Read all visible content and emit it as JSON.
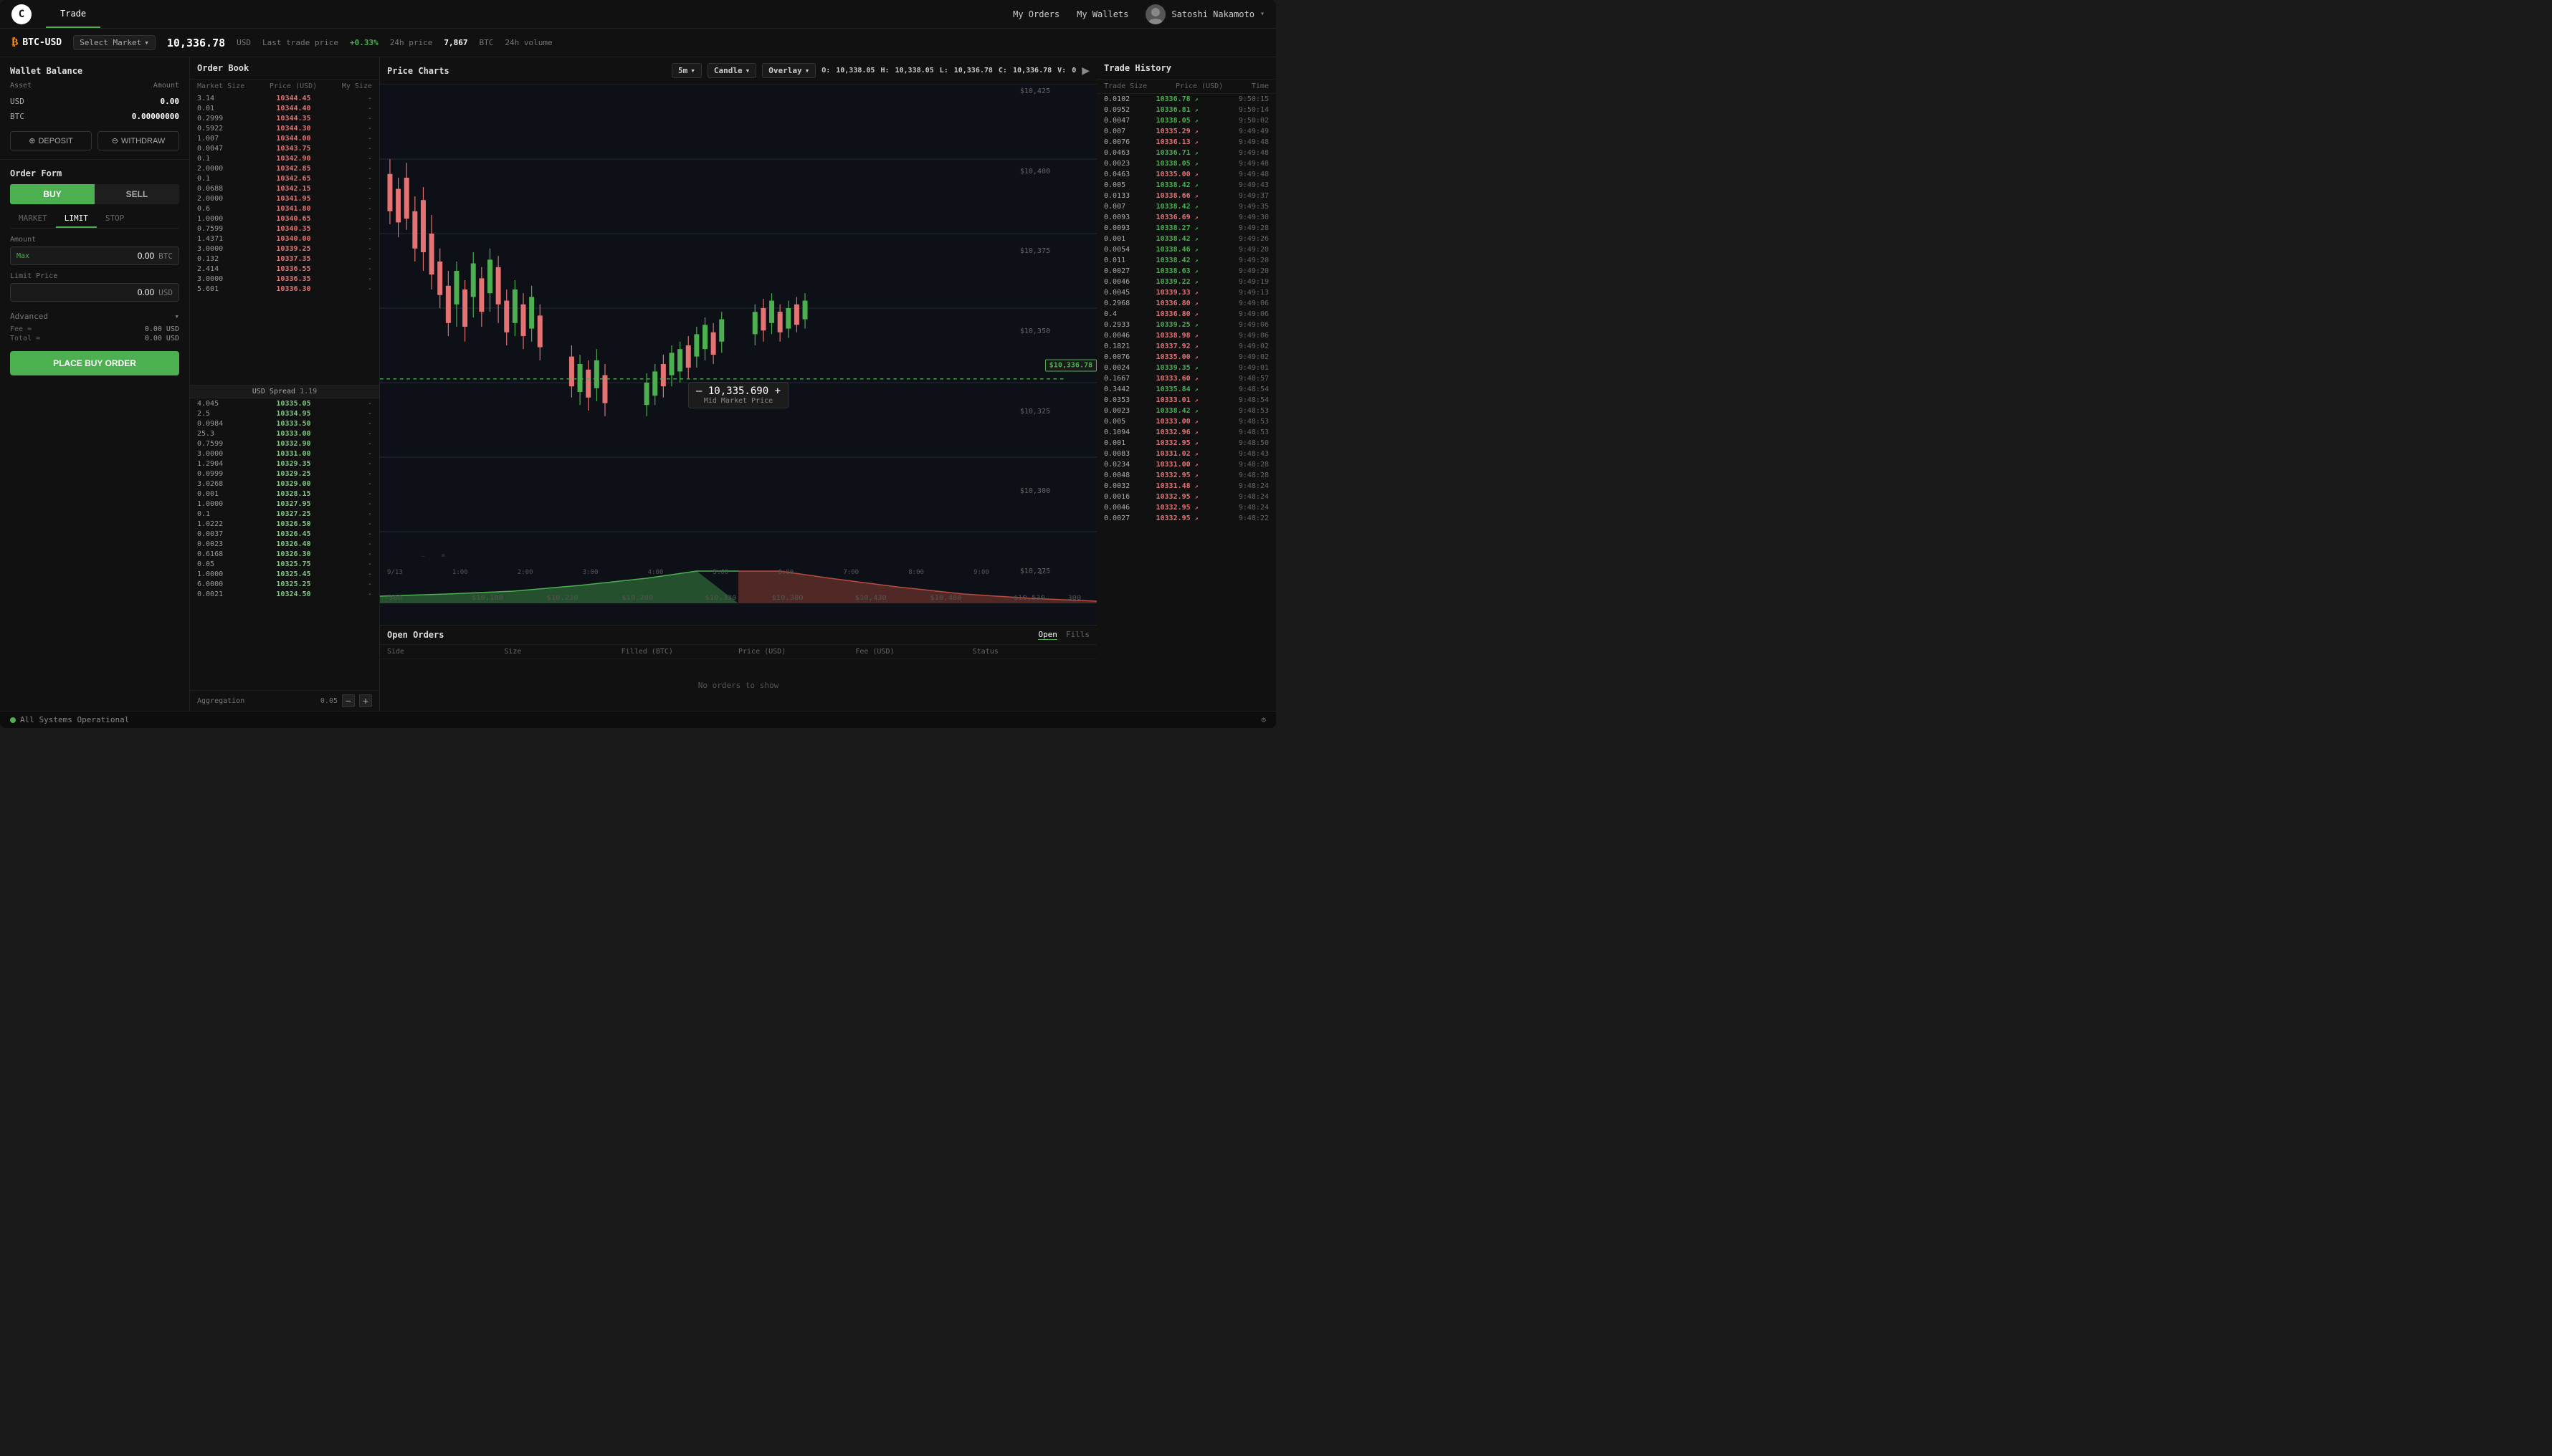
{
  "app": {
    "logo": "C",
    "nav_tabs": [
      {
        "label": "Trade",
        "active": true
      }
    ],
    "nav_right": {
      "my_orders": "My Orders",
      "my_wallets": "My Wallets",
      "user_name": "Satoshi Nakamoto"
    }
  },
  "ticker": {
    "pair": "BTC-USD",
    "icon": "₿",
    "select_market": "Select Market",
    "last_price": "10,336.78",
    "last_price_currency": "USD",
    "last_price_label": "Last trade price",
    "change_24h": "+0.33%",
    "change_label": "24h price",
    "volume_24h": "7,867",
    "volume_currency": "BTC",
    "volume_label": "24h volume"
  },
  "wallet": {
    "title": "Wallet Balance",
    "col_asset": "Asset",
    "col_amount": "Amount",
    "assets": [
      {
        "symbol": "USD",
        "amount": "0.00"
      },
      {
        "symbol": "BTC",
        "amount": "0.00000000"
      }
    ],
    "deposit_label": "DEPOSIT",
    "withdraw_label": "WITHDRAW"
  },
  "order_form": {
    "title": "Order Form",
    "buy_label": "BUY",
    "sell_label": "SELL",
    "order_types": [
      "MARKET",
      "LIMIT",
      "STOP"
    ],
    "active_type": "LIMIT",
    "amount_label": "Amount",
    "amount_max": "Max",
    "amount_value": "0.00",
    "amount_unit": "BTC",
    "limit_price_label": "Limit Price",
    "limit_value": "0.00",
    "limit_unit": "USD",
    "advanced_label": "Advanced",
    "fee_label": "Fee ≈",
    "fee_value": "0.00 USD",
    "total_label": "Total ≈",
    "total_value": "0.00 USD",
    "place_order_btn": "PLACE BUY ORDER"
  },
  "order_book": {
    "title": "Order Book",
    "col_market_size": "Market Size",
    "col_price": "Price (USD)",
    "col_my_size": "My Size",
    "asks": [
      {
        "size": "3.14",
        "price": "10344.45",
        "my_size": "-"
      },
      {
        "size": "0.01",
        "price": "10344.40",
        "my_size": "-"
      },
      {
        "size": "0.2999",
        "price": "10344.35",
        "my_size": "-"
      },
      {
        "size": "0.5922",
        "price": "10344.30",
        "my_size": "-"
      },
      {
        "size": "1.007",
        "price": "10344.00",
        "my_size": "-"
      },
      {
        "size": "0.0047",
        "price": "10343.75",
        "my_size": "-"
      },
      {
        "size": "0.1",
        "price": "10342.90",
        "my_size": "-"
      },
      {
        "size": "2.0000",
        "price": "10342.85",
        "my_size": "-"
      },
      {
        "size": "0.1",
        "price": "10342.65",
        "my_size": "-"
      },
      {
        "size": "0.0688",
        "price": "10342.15",
        "my_size": "-"
      },
      {
        "size": "2.0000",
        "price": "10341.95",
        "my_size": "-"
      },
      {
        "size": "0.6",
        "price": "10341.80",
        "my_size": "-"
      },
      {
        "size": "1.0000",
        "price": "10340.65",
        "my_size": "-"
      },
      {
        "size": "0.7599",
        "price": "10340.35",
        "my_size": "-"
      },
      {
        "size": "1.4371",
        "price": "10340.00",
        "my_size": "-"
      },
      {
        "size": "3.0000",
        "price": "10339.25",
        "my_size": "-"
      },
      {
        "size": "0.132",
        "price": "10337.35",
        "my_size": "-"
      },
      {
        "size": "2.414",
        "price": "10336.55",
        "my_size": "-"
      },
      {
        "size": "3.0000",
        "price": "10336.35",
        "my_size": "-"
      },
      {
        "size": "5.601",
        "price": "10336.30",
        "my_size": "-"
      }
    ],
    "spread_label": "USD Spread",
    "spread_value": "1.19",
    "bids": [
      {
        "size": "4.045",
        "price": "10335.05",
        "my_size": "-"
      },
      {
        "size": "2.5",
        "price": "10334.95",
        "my_size": "-"
      },
      {
        "size": "0.0984",
        "price": "10333.50",
        "my_size": "-"
      },
      {
        "size": "25.3",
        "price": "10333.00",
        "my_size": "-"
      },
      {
        "size": "0.7599",
        "price": "10332.90",
        "my_size": "-"
      },
      {
        "size": "3.0000",
        "price": "10331.00",
        "my_size": "-"
      },
      {
        "size": "1.2904",
        "price": "10329.35",
        "my_size": "-"
      },
      {
        "size": "0.0999",
        "price": "10329.25",
        "my_size": "-"
      },
      {
        "size": "3.0268",
        "price": "10329.00",
        "my_size": "-"
      },
      {
        "size": "0.001",
        "price": "10328.15",
        "my_size": "-"
      },
      {
        "size": "1.0000",
        "price": "10327.95",
        "my_size": "-"
      },
      {
        "size": "0.1",
        "price": "10327.25",
        "my_size": "-"
      },
      {
        "size": "1.0222",
        "price": "10326.50",
        "my_size": "-"
      },
      {
        "size": "0.0037",
        "price": "10326.45",
        "my_size": "-"
      },
      {
        "size": "0.0023",
        "price": "10326.40",
        "my_size": "-"
      },
      {
        "size": "0.6168",
        "price": "10326.30",
        "my_size": "-"
      },
      {
        "size": "0.05",
        "price": "10325.75",
        "my_size": "-"
      },
      {
        "size": "1.0000",
        "price": "10325.45",
        "my_size": "-"
      },
      {
        "size": "6.0000",
        "price": "10325.25",
        "my_size": "-"
      },
      {
        "size": "0.0021",
        "price": "10324.50",
        "my_size": "-"
      }
    ],
    "aggregation_label": "Aggregation",
    "aggregation_value": "0.05"
  },
  "price_chart": {
    "title": "Price Charts",
    "timeframe": "5m",
    "chart_type": "Candle",
    "overlay": "Overlay",
    "ohlcv": {
      "o_label": "O:",
      "o_val": "10,338.05",
      "h_label": "H:",
      "h_val": "10,338.05",
      "l_label": "L:",
      "l_val": "10,336.78",
      "c_label": "C:",
      "c_val": "10,336.78",
      "v_label": "V:",
      "v_val": "0"
    },
    "price_labels": [
      "$10,425",
      "$10,400",
      "$10,375",
      "$10,350",
      "$10,325",
      "$10,300",
      "$10,275"
    ],
    "current_price_label": "$10,336.78",
    "time_labels": [
      "9/13",
      "1:00",
      "2:00",
      "3:00",
      "4:00",
      "5:00",
      "6:00",
      "7:00",
      "8:00",
      "9:00",
      "1:"
    ],
    "mid_market_price": "— 10,335.690 +",
    "mid_market_label": "Mid Market Price",
    "depth_labels": [
      "-300",
      "$10,180",
      "$10,230",
      "$10,280",
      "$10,330",
      "$10,380",
      "$10,430",
      "$10,480",
      "$10,530",
      "300"
    ]
  },
  "open_orders": {
    "title": "Open Orders",
    "tabs": [
      "Open",
      "Fills"
    ],
    "active_tab": "Open",
    "columns": [
      "Side",
      "Size",
      "Filled (BTC)",
      "Price (USD)",
      "Fee (USD)",
      "Status"
    ],
    "empty_message": "No orders to show"
  },
  "trade_history": {
    "title": "Trade History",
    "col_size": "Trade Size",
    "col_price": "Price (USD)",
    "col_time": "Time",
    "rows": [
      {
        "size": "0.0102",
        "price": "10336.78",
        "dir": "up",
        "time": "9:50:15"
      },
      {
        "size": "0.0952",
        "price": "10336.81",
        "dir": "up",
        "time": "9:50:14"
      },
      {
        "size": "0.0047",
        "price": "10338.05",
        "dir": "up",
        "time": "9:50:02"
      },
      {
        "size": "0.007",
        "price": "10335.29",
        "dir": "dn",
        "time": "9:49:49"
      },
      {
        "size": "0.0076",
        "price": "10336.13",
        "dir": "dn",
        "time": "9:49:48"
      },
      {
        "size": "0.0463",
        "price": "10336.71",
        "dir": "up",
        "time": "9:49:48"
      },
      {
        "size": "0.0023",
        "price": "10338.05",
        "dir": "up",
        "time": "9:49:48"
      },
      {
        "size": "0.0463",
        "price": "10335.00",
        "dir": "dn",
        "time": "9:49:48"
      },
      {
        "size": "0.005",
        "price": "10338.42",
        "dir": "up",
        "time": "9:49:43"
      },
      {
        "size": "0.0133",
        "price": "10338.66",
        "dir": "dn",
        "time": "9:49:37"
      },
      {
        "size": "0.007",
        "price": "10338.42",
        "dir": "up",
        "time": "9:49:35"
      },
      {
        "size": "0.0093",
        "price": "10336.69",
        "dir": "dn",
        "time": "9:49:30"
      },
      {
        "size": "0.0093",
        "price": "10338.27",
        "dir": "up",
        "time": "9:49:28"
      },
      {
        "size": "0.001",
        "price": "10338.42",
        "dir": "up",
        "time": "9:49:26"
      },
      {
        "size": "0.0054",
        "price": "10338.46",
        "dir": "up",
        "time": "9:49:20"
      },
      {
        "size": "0.011",
        "price": "10338.42",
        "dir": "up",
        "time": "9:49:20"
      },
      {
        "size": "0.0027",
        "price": "10338.63",
        "dir": "up",
        "time": "9:49:20"
      },
      {
        "size": "0.0046",
        "price": "10339.22",
        "dir": "up",
        "time": "9:49:19"
      },
      {
        "size": "0.0045",
        "price": "10339.33",
        "dir": "dn",
        "time": "9:49:13"
      },
      {
        "size": "0.2968",
        "price": "10336.80",
        "dir": "dn",
        "time": "9:49:06"
      },
      {
        "size": "0.4",
        "price": "10336.80",
        "dir": "dn",
        "time": "9:49:06"
      },
      {
        "size": "0.2933",
        "price": "10339.25",
        "dir": "up",
        "time": "9:49:06"
      },
      {
        "size": "0.0046",
        "price": "10338.98",
        "dir": "dn",
        "time": "9:49:06"
      },
      {
        "size": "0.1821",
        "price": "10337.92",
        "dir": "dn",
        "time": "9:49:02"
      },
      {
        "size": "0.0076",
        "price": "10335.00",
        "dir": "dn",
        "time": "9:49:02"
      },
      {
        "size": "0.0024",
        "price": "10339.35",
        "dir": "up",
        "time": "9:49:01"
      },
      {
        "size": "0.1667",
        "price": "10333.60",
        "dir": "dn",
        "time": "9:48:57"
      },
      {
        "size": "0.3442",
        "price": "10335.84",
        "dir": "up",
        "time": "9:48:54"
      },
      {
        "size": "0.0353",
        "price": "10333.01",
        "dir": "dn",
        "time": "9:48:54"
      },
      {
        "size": "0.0023",
        "price": "10338.42",
        "dir": "up",
        "time": "9:48:53"
      },
      {
        "size": "0.005",
        "price": "10333.00",
        "dir": "dn",
        "time": "9:48:53"
      },
      {
        "size": "0.1094",
        "price": "10332.96",
        "dir": "dn",
        "time": "9:48:53"
      },
      {
        "size": "0.001",
        "price": "10332.95",
        "dir": "dn",
        "time": "9:48:50"
      },
      {
        "size": "0.0083",
        "price": "10331.02",
        "dir": "dn",
        "time": "9:48:43"
      },
      {
        "size": "0.0234",
        "price": "10331.00",
        "dir": "dn",
        "time": "9:48:28"
      },
      {
        "size": "0.0048",
        "price": "10332.95",
        "dir": "dn",
        "time": "9:48:28"
      },
      {
        "size": "0.0032",
        "price": "10331.48",
        "dir": "dn",
        "time": "9:48:24"
      },
      {
        "size": "0.0016",
        "price": "10332.95",
        "dir": "dn",
        "time": "9:48:24"
      },
      {
        "size": "0.0046",
        "price": "10332.95",
        "dir": "dn",
        "time": "9:48:24"
      },
      {
        "size": "0.0027",
        "price": "10332.95",
        "dir": "dn",
        "time": "9:48:22"
      }
    ]
  },
  "status_bar": {
    "dot_color": "#4caf50",
    "status_text": "All Systems Operational"
  }
}
